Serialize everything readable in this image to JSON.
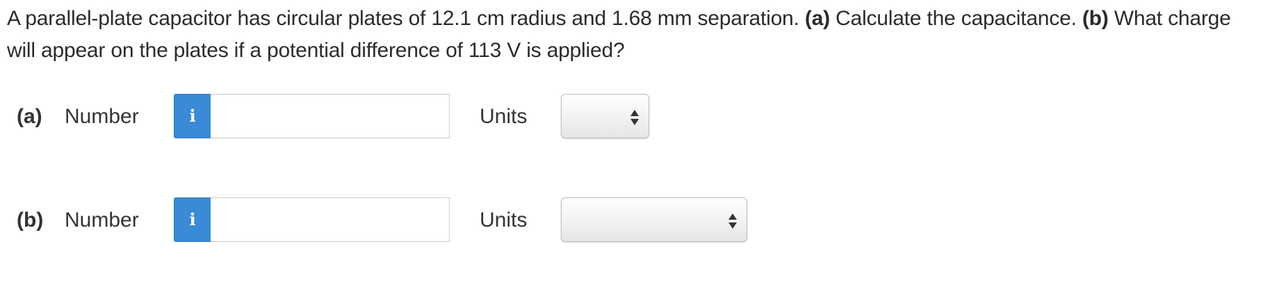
{
  "question": {
    "line1_text": "A parallel-plate capacitor has circular plates of 12.1 cm radius and 1.68 mm separation. ",
    "line1_part_a": "(a)",
    "line1_text_a": " Calculate the capacitance. ",
    "line1_part_b": "(b)",
    "line1_text_b": " What charge",
    "line2_text": "will appear on the plates if a potential difference of 113 V is applied?"
  },
  "answers": [
    {
      "part_label": "(a)",
      "number_label": "Number",
      "info_icon": "info-icon",
      "number_value": "",
      "units_label": "Units",
      "units_selected": ""
    },
    {
      "part_label": "(b)",
      "number_label": "Number",
      "info_icon": "info-icon",
      "number_value": "",
      "units_label": "Units",
      "units_selected": ""
    }
  ],
  "colors": {
    "info_button": "#3a8ad8",
    "text": "#2b2b2b"
  }
}
